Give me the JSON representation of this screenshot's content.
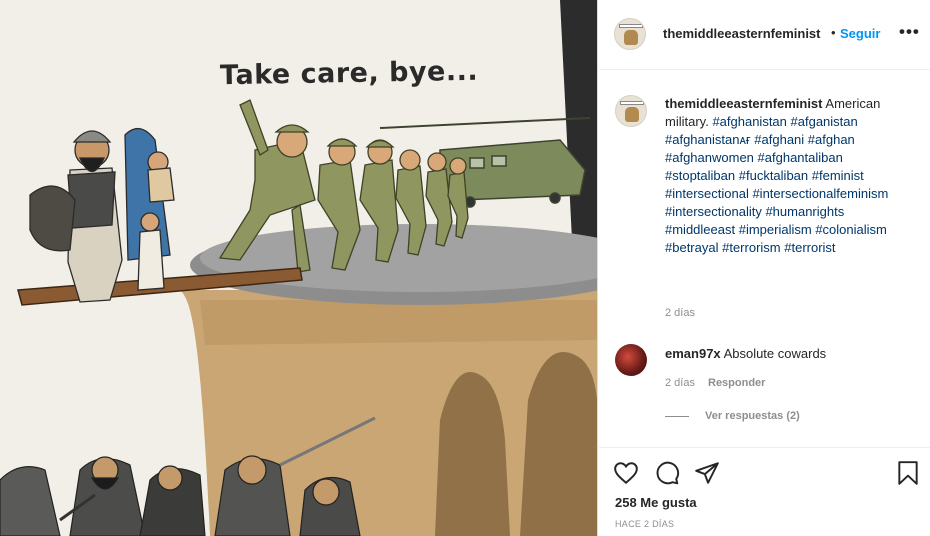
{
  "post": {
    "image_text": "Take care, bye...",
    "image_description_icon": "cartoon-illustration"
  },
  "header": {
    "username": "themiddleeasternfeminist",
    "dot": "•",
    "follow_label": "Seguir",
    "more_icon": "more-horizontal-icon",
    "more_label": "•••"
  },
  "caption": {
    "username": "themiddleeasternfeminist",
    "text": "American military.",
    "hashtags": [
      "#afghanistan",
      "#afganistan",
      "#afghanistanᴀғ",
      "#afghani",
      "#afghan",
      "#afghanwomen",
      "#afghantaliban",
      "#stoptaliban",
      "#fucktaliban",
      "#feminist",
      "#intersectional",
      "#intersectionalfeminism",
      "#intersectionality",
      "#humanrights",
      "#middleeast",
      "#imperialism",
      "#colonialism",
      "#betrayal",
      "#terrorism",
      "#terrorist"
    ],
    "time": "2 días"
  },
  "comment": {
    "username": "eman97x",
    "text": "Absolute cowards",
    "time": "2 días",
    "reply_label": "Responder",
    "view_replies": "Ver respuestas (2)"
  },
  "actions": {
    "icons": [
      "heart-icon",
      "comment-icon",
      "share-icon",
      "bookmark-icon"
    ],
    "likes": "258 Me gusta",
    "posted_ago": "HACE 2 DÍAS"
  },
  "colors": {
    "link_blue": "#0095f6",
    "hashtag": "#00376b",
    "muted": "#8e8e8e"
  }
}
